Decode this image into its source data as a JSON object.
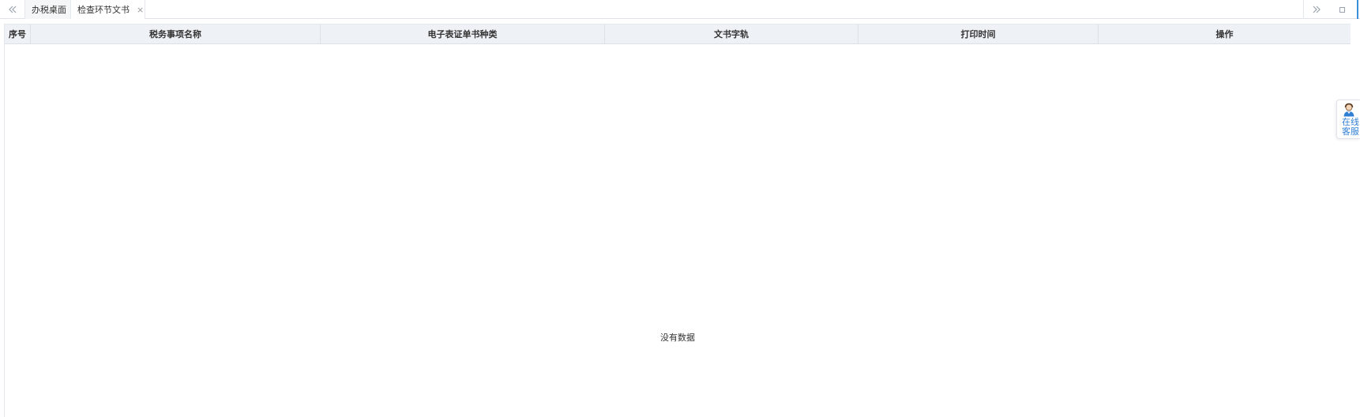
{
  "tabs": {
    "items": [
      {
        "label": "办税桌面"
      },
      {
        "label": "检查环节文书"
      }
    ],
    "close_glyph": "×",
    "prev_icon": "double-chevron-left-icon",
    "next_icon": "double-chevron-right-icon",
    "maximize_icon": "square-icon"
  },
  "table": {
    "columns": [
      {
        "label": "序号"
      },
      {
        "label": "税务事项名称"
      },
      {
        "label": "电子表证单书种类"
      },
      {
        "label": "文书字轨"
      },
      {
        "label": "打印时间"
      },
      {
        "label": "操作"
      }
    ],
    "empty_text": "没有数据"
  },
  "service_widget": {
    "line1": "在线",
    "line2": "客服",
    "icon": "customer-service-avatar-icon",
    "color": "#2f7fd4"
  },
  "colors": {
    "header_bg": "#eef1f5",
    "accent": "#3b8fd9"
  }
}
